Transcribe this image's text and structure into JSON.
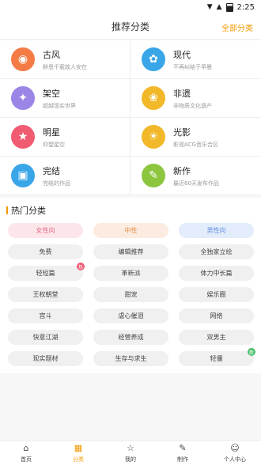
{
  "statusbar": {
    "time": "2:25",
    "wifi_icon": "▼",
    "signal_icon": "▲"
  },
  "header": {
    "title": "推荐分类",
    "right_label": "全部分类"
  },
  "categories": [
    {
      "name": "古风",
      "desc": "鲜思千载故人安在",
      "color": "#f47b45",
      "icon": "fan-icon",
      "glyph": "◉"
    },
    {
      "name": "现代",
      "desc": "不再纠结于早晨",
      "color": "#39a6e8",
      "icon": "flower-icon",
      "glyph": "✿"
    },
    {
      "name": "架空",
      "desc": "超越现实世界",
      "color": "#9b86e8",
      "icon": "planet-icon",
      "glyph": "✦"
    },
    {
      "name": "非遗",
      "desc": "非物质文化遗产",
      "color": "#f1b82a",
      "icon": "bloom-icon",
      "glyph": "❀"
    },
    {
      "name": "明星",
      "desc": "仰望星空",
      "color": "#f05b72",
      "icon": "star-glasses-icon",
      "glyph": "★"
    },
    {
      "name": "光影",
      "desc": "影视ACG音乐合区",
      "color": "#f1b82a",
      "icon": "sun-icon",
      "glyph": "☀"
    },
    {
      "name": "完结",
      "desc": "完结的作品",
      "color": "#39a6e8",
      "icon": "book-check-icon",
      "glyph": "▣"
    },
    {
      "name": "新作",
      "desc": "最近60天发布作品",
      "color": "#8cc63f",
      "icon": "new-doc-icon",
      "glyph": "✎"
    }
  ],
  "hot": {
    "title": "热门分类",
    "tags": [
      {
        "label": "女性向",
        "bg": "#fde6ea",
        "color": "#e66a84",
        "badge": ""
      },
      {
        "label": "中性",
        "bg": "#fbebe0",
        "color": "#e88f4a",
        "badge": ""
      },
      {
        "label": "男性向",
        "bg": "#e3ecfb",
        "color": "#5f8fe0",
        "badge": ""
      },
      {
        "label": "免费",
        "bg": "#f0f0f0",
        "color": "#444",
        "badge": ""
      },
      {
        "label": "编辑推荐",
        "bg": "#f0f0f0",
        "color": "#444",
        "badge": ""
      },
      {
        "label": "全独家立绘",
        "bg": "#f0f0f0",
        "color": "#444",
        "badge": ""
      },
      {
        "label": "轻短篇",
        "bg": "#f0f0f0",
        "color": "#444",
        "badge": "热",
        "badge_color": "#f05b72"
      },
      {
        "label": "革新派",
        "bg": "#f0f0f0",
        "color": "#444",
        "badge": ""
      },
      {
        "label": "体力中长篇",
        "bg": "#f0f0f0",
        "color": "#444",
        "badge": ""
      },
      {
        "label": "王权朝堂",
        "bg": "#f0f0f0",
        "color": "#444",
        "badge": ""
      },
      {
        "label": "甜宠",
        "bg": "#f0f0f0",
        "color": "#444",
        "badge": ""
      },
      {
        "label": "娱乐圈",
        "bg": "#f0f0f0",
        "color": "#444",
        "badge": ""
      },
      {
        "label": "宫斗",
        "bg": "#f0f0f0",
        "color": "#444",
        "badge": ""
      },
      {
        "label": "虐心催泪",
        "bg": "#f0f0f0",
        "color": "#444",
        "badge": ""
      },
      {
        "label": "网络",
        "bg": "#f0f0f0",
        "color": "#444",
        "badge": ""
      },
      {
        "label": "快意江湖",
        "bg": "#f0f0f0",
        "color": "#444",
        "badge": ""
      },
      {
        "label": "经营养成",
        "bg": "#f0f0f0",
        "color": "#444",
        "badge": ""
      },
      {
        "label": "双男主",
        "bg": "#f0f0f0",
        "color": "#444",
        "badge": ""
      },
      {
        "label": "现实题材",
        "bg": "#f0f0f0",
        "color": "#444",
        "badge": ""
      },
      {
        "label": "生存与求生",
        "bg": "#f0f0f0",
        "color": "#444",
        "badge": ""
      },
      {
        "label": "轻僵",
        "bg": "#f0f0f0",
        "color": "#444",
        "badge": "新",
        "badge_color": "#4bbf6b"
      }
    ]
  },
  "tabs": [
    {
      "label": "首页",
      "icon": "home-icon",
      "glyph": "⌂",
      "active": false
    },
    {
      "label": "分类",
      "icon": "grid-icon",
      "glyph": "▦",
      "active": true
    },
    {
      "label": "我的",
      "icon": "star-outline-icon",
      "glyph": "☆",
      "active": false
    },
    {
      "label": "制作",
      "icon": "edit-icon",
      "glyph": "✎",
      "active": false
    },
    {
      "label": "个人中心",
      "icon": "user-icon",
      "glyph": "☺",
      "active": false
    }
  ]
}
